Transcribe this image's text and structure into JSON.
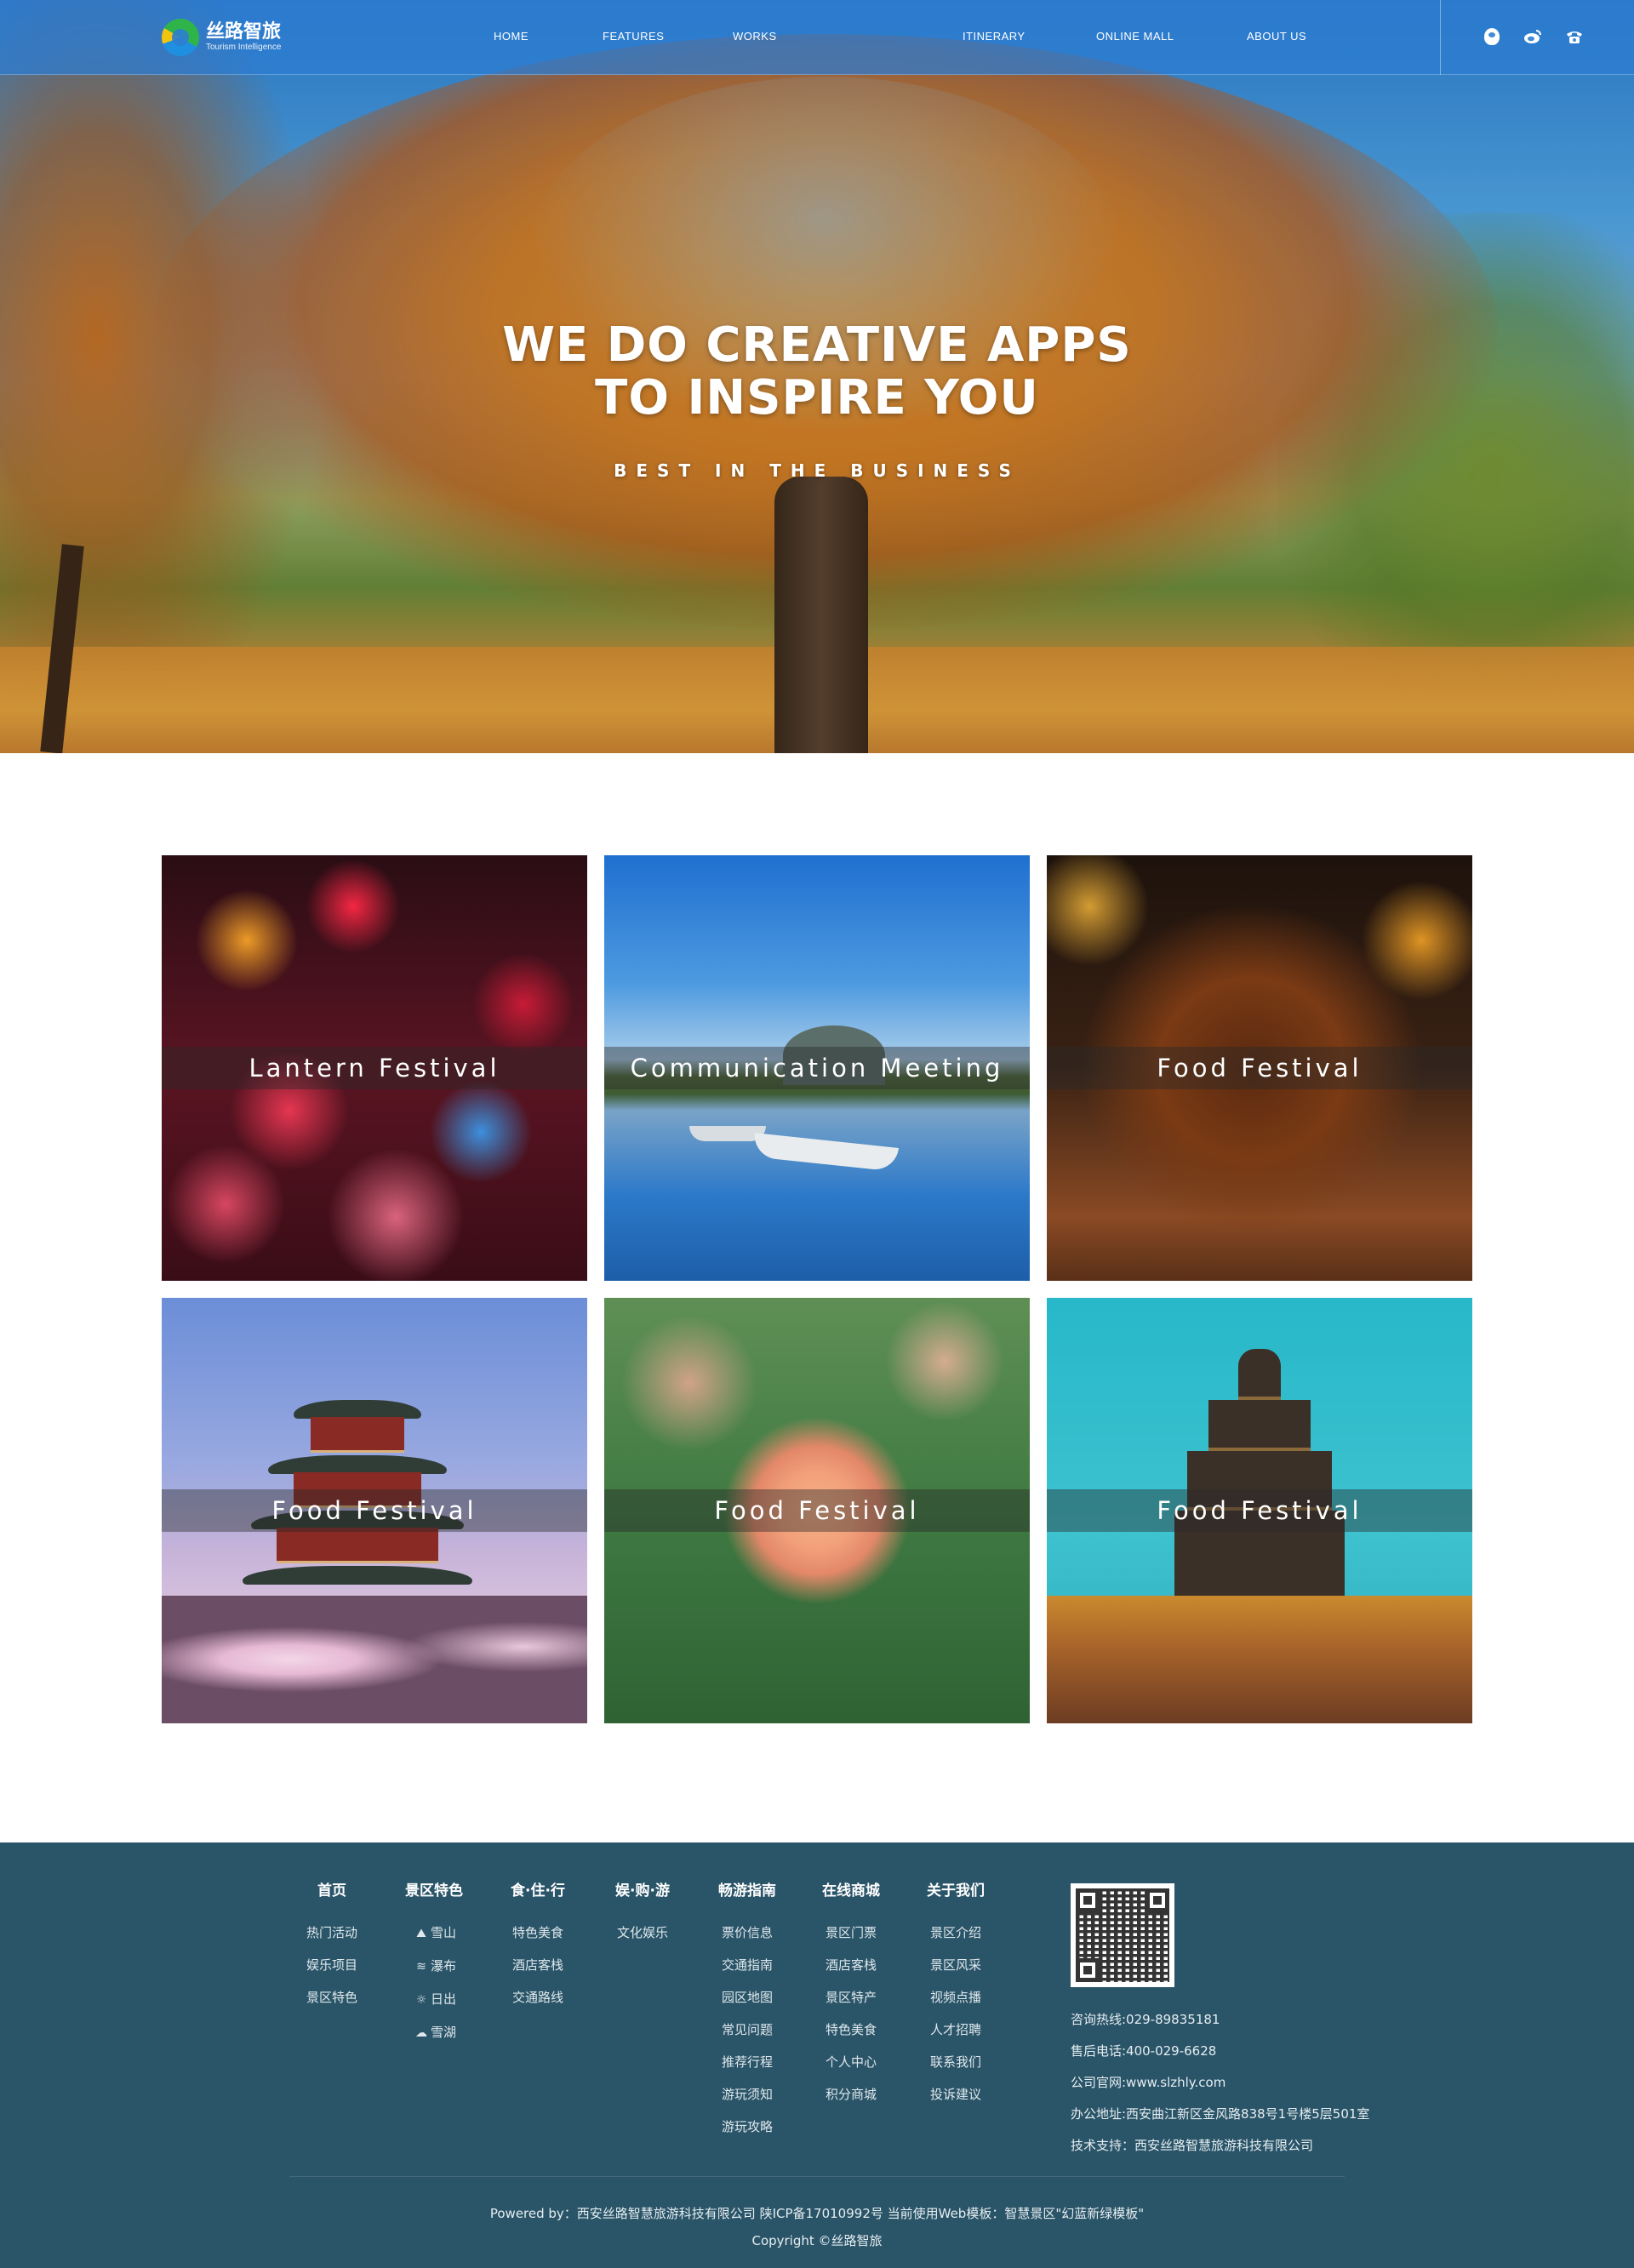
{
  "brand": {
    "name_cn": "丝路智旅",
    "name_en": "Tourism Intelligence"
  },
  "nav": {
    "links": [
      "HOME",
      "FEATURES",
      "WORKS",
      "ITINERARY",
      "ONLINE MALL",
      "ABOUT US"
    ],
    "icons": [
      "qq-icon",
      "weibo-icon",
      "phone-icon"
    ]
  },
  "hero": {
    "title_line1": "WE DO CREATIVE APPS",
    "title_line2": "TO INSPIRE YOU",
    "subtitle": "BEST IN THE BUSINESS"
  },
  "gallery": {
    "cards": [
      {
        "caption": "Lantern Festival"
      },
      {
        "caption": "Communication Meeting"
      },
      {
        "caption": "Food Festival"
      },
      {
        "caption": "Food Festival"
      },
      {
        "caption": "Food Festival"
      },
      {
        "caption": "Food Festival"
      }
    ]
  },
  "footer": {
    "columns": [
      {
        "title": "首页",
        "items": [
          "热门活动",
          "娱乐项目",
          "景区特色"
        ]
      },
      {
        "title": "景区特色",
        "items": [
          "雪山",
          "瀑布",
          "日出",
          "雪湖"
        ],
        "icons": [
          "mountain-icon",
          "waterfall-icon",
          "sunrise-icon",
          "lake-icon"
        ]
      },
      {
        "title": "食·住·行",
        "items": [
          "特色美食",
          "酒店客栈",
          "交通路线"
        ]
      },
      {
        "title": "娱·购·游",
        "items": [
          "文化娱乐"
        ]
      },
      {
        "title": "畅游指南",
        "items": [
          "票价信息",
          "交通指南",
          "园区地图",
          "常见问题",
          "推荐行程",
          "游玩须知",
          "游玩攻略"
        ]
      },
      {
        "title": "在线商城",
        "items": [
          "景区门票",
          "酒店客栈",
          "景区特产",
          "特色美食",
          "个人中心",
          "积分商城"
        ]
      },
      {
        "title": "关于我们",
        "items": [
          "景区介绍",
          "景区风采",
          "视频点播",
          "人才招聘",
          "联系我们",
          "投诉建议"
        ]
      }
    ],
    "contact": {
      "hotline": "咨询热线:029-89835181",
      "aftersales": "售后电话:400-029-6628",
      "website": "公司官网:www.slzhly.com",
      "address": "办公地址:西安曲江新区金风路838号1号楼5层501室",
      "support": "技术支持：西安丝路智慧旅游科技有限公司"
    },
    "powered_by": "Powered by：西安丝路智慧旅游科技有限公司 陕ICP备17010992号 当前使用Web模板：智慧景区\"幻蓝新绿模板\"",
    "copyright": "Copyright ©丝路智旅"
  }
}
